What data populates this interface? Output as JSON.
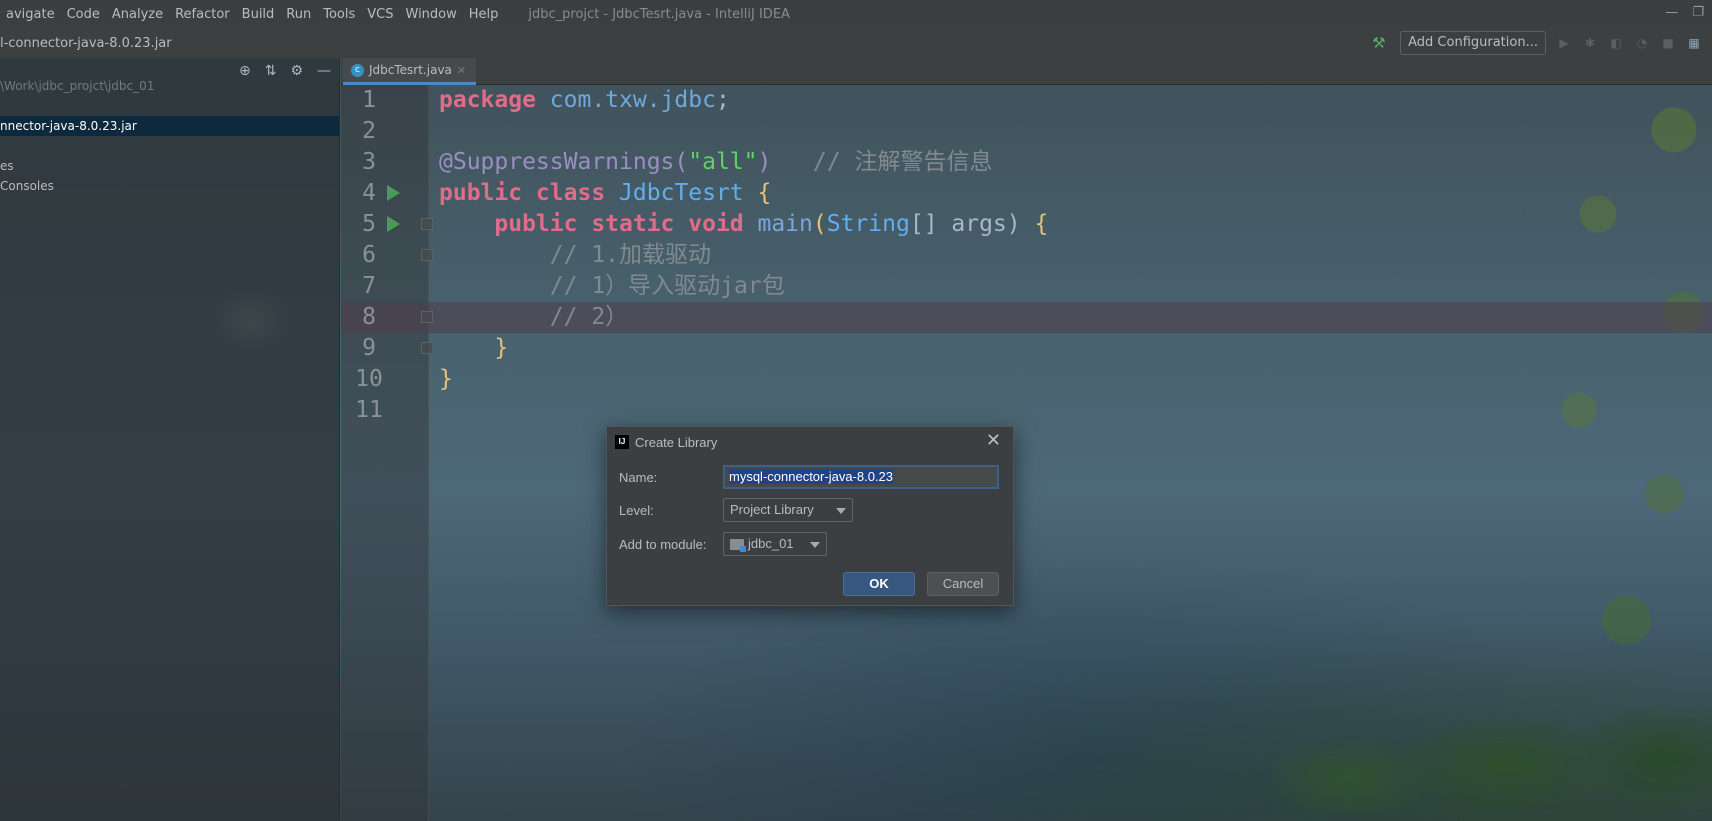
{
  "menubar": {
    "items": [
      "avigate",
      "Code",
      "Analyze",
      "Refactor",
      "Build",
      "Run",
      "Tools",
      "VCS",
      "Window",
      "Help"
    ],
    "window_title": "jdbc_projct - JdbcTesrt.java - IntelliJ IDEA"
  },
  "navbar": {
    "breadcrumb": "l-connector-java-8.0.23.jar",
    "add_configuration": "Add Configuration..."
  },
  "project": {
    "rows": [
      {
        "label": "\\Work\\jdbc_projct\\jdbc_01",
        "state": "dim"
      },
      {
        "label": "",
        "state": "normal"
      },
      {
        "label": "nnector-java-8.0.23.jar",
        "state": "selected"
      },
      {
        "label": "",
        "state": "normal"
      },
      {
        "label": "es",
        "state": "normal"
      },
      {
        "label": "Consoles",
        "state": "normal"
      }
    ]
  },
  "editor": {
    "tab_label": "JdbcTesrt.java",
    "current_line": 8,
    "line_numbers": [
      "1",
      "2",
      "3",
      "4",
      "5",
      "6",
      "7",
      "8",
      "9",
      "10",
      "11"
    ],
    "lines": {
      "l1_kw": "package",
      "l1_pkg": "com.txw.jdbc",
      "l1_end": ";",
      "l3_ann": "@SuppressWarnings(",
      "l3_str": "\"all\"",
      "l3_close": ")",
      "l3_comment": "// 注解警告信息",
      "l4_kw": "public class",
      "l4_cls": "JdbcTesrt",
      "l4_brace": "{",
      "l5_kw": "public static void",
      "l5_fn": "main",
      "l5_open": "(",
      "l5_type": "String",
      "l5_rest": "[] args)",
      "l5_brace": "{",
      "l6_comment": "// 1.加载驱动",
      "l7_comment": "// 1）导入驱动jar包",
      "l8_comment": "// 2）",
      "l9_brace": "}",
      "l10_brace": "}"
    }
  },
  "dialog": {
    "title": "Create Library",
    "name_label": "Name:",
    "name_value": "mysql-connector-java-8.0.23",
    "level_label": "Level:",
    "level_value": "Project Library",
    "module_label": "Add to module:",
    "module_value": "jdbc_01",
    "ok_label": "OK",
    "cancel_label": "Cancel"
  },
  "colors": {
    "accent": "#4a88c7",
    "selection": "#214283",
    "run_green": "#499c54"
  }
}
